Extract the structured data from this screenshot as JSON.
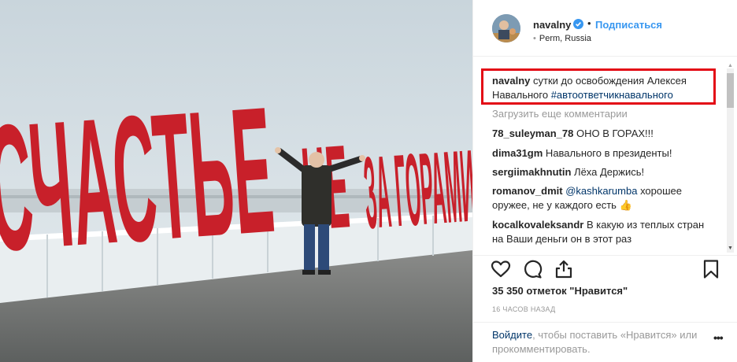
{
  "photo": {
    "sign_text": "СЧАСТЬЕ НЕ ЗА ГОРАМИ"
  },
  "header": {
    "username": "navalny",
    "dot": "•",
    "follow_label": "Подписаться",
    "location": "Perm, Russia"
  },
  "caption": {
    "username": "navalny",
    "text": " сутки до освобождения Алексея Навального ",
    "hashtag": "#автоответчикнавального"
  },
  "load_more": "Загрузить еще комментарии",
  "comments": [
    {
      "user": "78_suleyman_78",
      "text": " ОНО В ГОРАХ!!!"
    },
    {
      "user": "dima31gm",
      "text": " Навального в президенты!"
    },
    {
      "user": "sergiimakhnutin",
      "text": " Лёха Держись!"
    },
    {
      "user": "romanov_dmit",
      "mention": "@kashkarumba",
      "text": " хорошее оружее, не у каждого есть 👍"
    },
    {
      "user": "kocalkovaleksandr",
      "text": " В какую из теплых стран на Ваши деньги он в этот раз"
    }
  ],
  "likes": "35 350 отметок \"Нравится\"",
  "time_ago": "16 ЧАСОВ НАЗАД",
  "login": {
    "link": "Войдите",
    "text": ", чтобы поставить «Нравится» или прокомментировать."
  },
  "more_dots": "•••",
  "colors": {
    "accent_blue": "#3897f0",
    "link_dark": "#003569",
    "highlight_red": "#e30b16",
    "sign_red": "#c8202a"
  },
  "icons": [
    "heart-icon",
    "comment-icon",
    "share-icon",
    "bookmark-icon",
    "verified-icon",
    "more-icon"
  ]
}
